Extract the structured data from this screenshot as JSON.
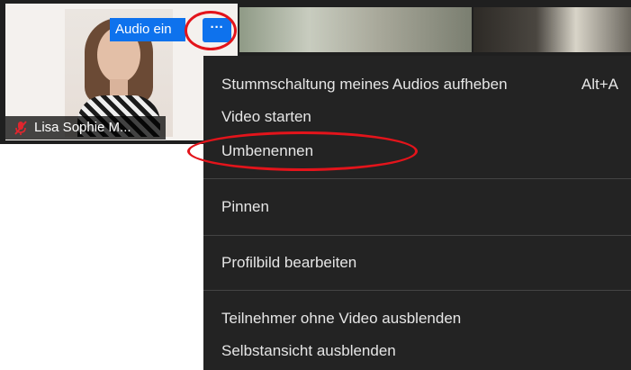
{
  "participant": {
    "name": "Lisa Sophie M..."
  },
  "tile_controls": {
    "audio_button_label": "Audio ein",
    "more_button_label": "···"
  },
  "context_menu": {
    "unmute": {
      "label": "Stummschaltung meines Audios aufheben",
      "shortcut": "Alt+A"
    },
    "start_video": {
      "label": "Video starten"
    },
    "rename": {
      "label": "Umbenennen"
    },
    "pin": {
      "label": "Pinnen"
    },
    "edit_profile_picture": {
      "label": "Profilbild bearbeiten"
    },
    "hide_non_video": {
      "label": "Teilnehmer ohne Video ausblenden"
    },
    "hide_self_view": {
      "label": "Selbstansicht ausblenden"
    }
  },
  "colors": {
    "accent_blue": "#0e72ed",
    "annotation_red": "#e3141b",
    "menu_background": "#232323",
    "muted_mic_red": "#e0262e"
  }
}
